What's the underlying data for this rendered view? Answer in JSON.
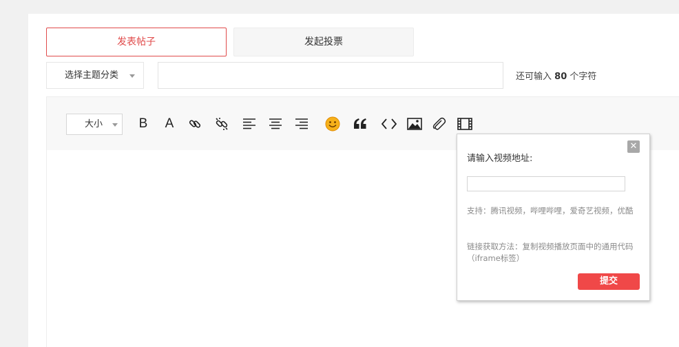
{
  "tabs": {
    "post_label": "发表帖子",
    "vote_label": "发起投票"
  },
  "form": {
    "category_label": "选择主题分类",
    "title_value": "",
    "char_hint_prefix": "还可输入",
    "char_hint_count": "80",
    "char_hint_suffix": "个字符"
  },
  "toolbar": {
    "size_label": "大小",
    "bold_label": "B",
    "font_color_label": "A",
    "tools": [
      "bold",
      "font-color",
      "link",
      "unlink",
      "align-left",
      "align-center",
      "align-right",
      "emoji",
      "quote",
      "code",
      "image",
      "attachment",
      "video"
    ]
  },
  "video_popup": {
    "close_label": "✕",
    "label": "请输入视频地址:",
    "input_value": "",
    "support_note": "支持：腾讯视频，哔哩哔哩，爱奇艺视频，优酷",
    "method_note": "链接获取方法：复制视频播放页面中的通用代码（iframe标签）",
    "submit_label": "提交"
  },
  "colors": {
    "accent": "#e04a4a",
    "submit_bg": "#f04848",
    "page_bg": "#f1f1f1"
  }
}
